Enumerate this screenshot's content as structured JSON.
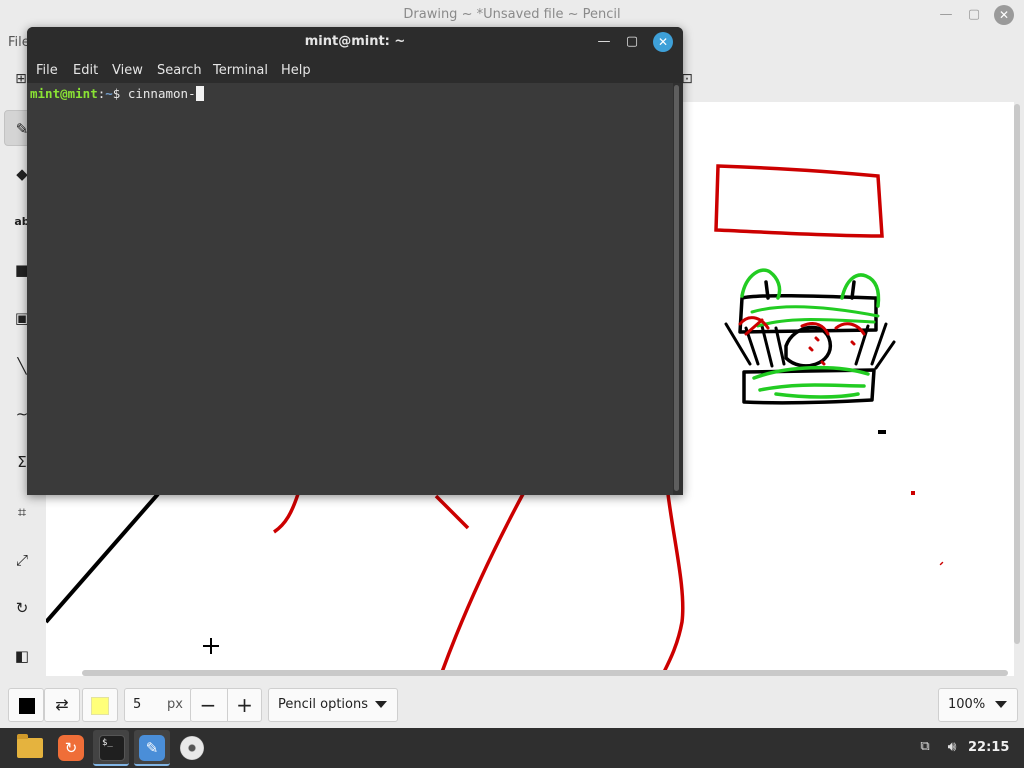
{
  "app": {
    "title": "Drawing ~ *Unsaved file ~ Pencil",
    "menu_file": "File"
  },
  "terminal": {
    "title": "mint@mint: ~",
    "menu": [
      "File",
      "Edit",
      "View",
      "Search",
      "Terminal",
      "Help"
    ],
    "prompt_user": "mint@mint",
    "prompt_sep": ":",
    "prompt_path": "~",
    "prompt_symbol": "$ ",
    "command": "cinnamon-"
  },
  "bottom_bar": {
    "size_value": "5",
    "size_unit": "px",
    "minus": "−",
    "plus": "+",
    "options_label": "Pencil options",
    "zoom_label": "100%",
    "main_color": "#000000",
    "secondary_color": "#ffff7a"
  },
  "taskbar": {
    "clock": "22:15",
    "terminal_glyph": "$_"
  },
  "colors": {
    "accent_blue": "#3ea0d8",
    "prompt_green": "#8ae234",
    "drawing_red": "#cc0000",
    "drawing_green": "#22cc22"
  }
}
